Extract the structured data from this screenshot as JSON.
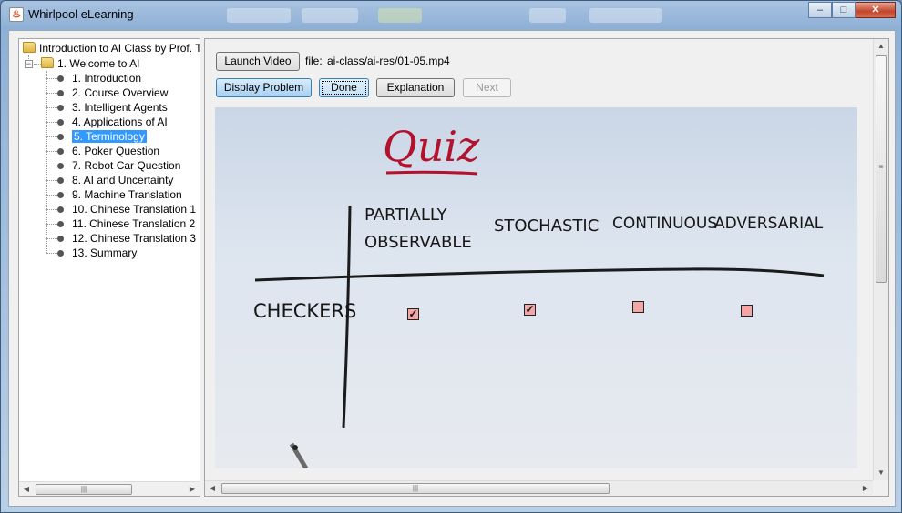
{
  "window": {
    "title": "Whirlpool eLearning",
    "minimize_glyph": "–",
    "maximize_glyph": "□",
    "close_glyph": "✕"
  },
  "tree": {
    "root_label": "Introduction to AI Class by Prof. Thru",
    "chapter_label": "1. Welcome to AI",
    "toggle_glyph": "−",
    "items": [
      {
        "label": "1. Introduction"
      },
      {
        "label": "2. Course Overview"
      },
      {
        "label": "3. Intelligent Agents"
      },
      {
        "label": "4. Applications of AI"
      },
      {
        "label": "5. Terminology",
        "selected": true
      },
      {
        "label": "6. Poker Question"
      },
      {
        "label": "7. Robot Car Question"
      },
      {
        "label": "8. AI and Uncertainty"
      },
      {
        "label": "9. Machine Translation"
      },
      {
        "label": "10. Chinese Translation 1"
      },
      {
        "label": "11. Chinese Translation 2"
      },
      {
        "label": "12. Chinese Translation 3"
      },
      {
        "label": "13. Summary"
      }
    ]
  },
  "toolbar": {
    "launch_video": "Launch Video",
    "file_label": "file:",
    "file_path": "ai-class/ai-res/01-05.mp4",
    "display_problem": "Display Problem",
    "done": "Done",
    "explanation": "Explanation",
    "next": "Next"
  },
  "video": {
    "title": "Quiz",
    "columns": [
      "PARTIALLY OBSERVABLE",
      "STOCHASTIC",
      "CONTINUOUS",
      "ADVERSARIAL"
    ],
    "row_label": "CHECKERS",
    "checkboxes": [
      true,
      true,
      false,
      false
    ],
    "check_glyph": "✓"
  },
  "scrollbar": {
    "left_arrow": "◀",
    "right_arrow": "▶",
    "up_arrow": "▲",
    "down_arrow": "▼",
    "grip": "|||",
    "vgrip": "≡"
  },
  "colors": {
    "selection": "#3399ff",
    "quiz_title": "#b3122e",
    "checkbox_fill": "#f4a6a6"
  }
}
